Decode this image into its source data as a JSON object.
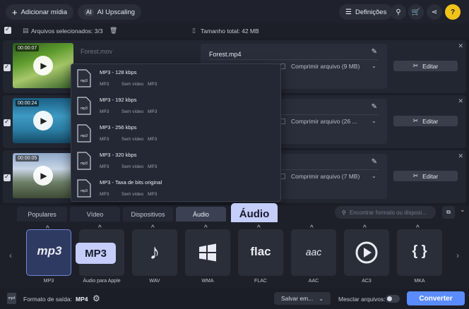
{
  "toolbar": {
    "add_media_label": "Adicionar mídia",
    "ai_upscaling_label": "AI Upscaling",
    "settings_label": "Definições"
  },
  "selection": {
    "selected_label": "Arquivos selecionados: 3/3",
    "total_size_label": "Tamanho total: 42 MB"
  },
  "files": [
    {
      "duration": "00:00:07",
      "input_name": "Forest.mov",
      "output_name": "Forest.mp4",
      "compress_label": "Comprimir arquivo (9 MB)",
      "edit_label": "Editar"
    },
    {
      "duration": "00:00:24",
      "input_name": "",
      "output_name": "",
      "compress_label": "Comprimir arquivo (26 ...",
      "edit_label": "Editar"
    },
    {
      "duration": "00:00:05",
      "input_name": "",
      "output_name": "",
      "compress_label": "Comprimir arquivo (7 MB)",
      "edit_label": "Editar"
    }
  ],
  "dropdown": {
    "items": [
      {
        "name": "MP3 - 128 kbps",
        "col1": "MP3",
        "col2": "Sem vídeo",
        "col3": "MP3"
      },
      {
        "name": "MP3 - 192 kbps",
        "col1": "MP3",
        "col2": "Sem vídeo",
        "col3": "MP3"
      },
      {
        "name": "MP3 - 256 kbps",
        "col1": "MP3",
        "col2": "Sem vídeo",
        "col3": "MP3"
      },
      {
        "name": "MP3 - 320 kbps",
        "col1": "MP3",
        "col2": "Sem vídeo",
        "col3": "MP3"
      },
      {
        "name": "MP3 - Taxa de bits original",
        "col1": "MP3",
        "col2": "Sem vídeo",
        "col3": "MP3"
      }
    ]
  },
  "tabs": [
    {
      "label": "Populares"
    },
    {
      "label": "Vídeo"
    },
    {
      "label": "Dispositivos"
    },
    {
      "label": "Áudio"
    }
  ],
  "search": {
    "placeholder": "Encontrar formato ou disposi..."
  },
  "tooltips": {
    "audio": "Áudio",
    "mp3": "MP3"
  },
  "formats": [
    {
      "label": "MP3",
      "icon": "mp3-icon"
    },
    {
      "label": "Áudio para Apple",
      "icon": "apple-audio-icon"
    },
    {
      "label": "WAV",
      "icon": "music-note-icon"
    },
    {
      "label": "WMA",
      "icon": "windows-icon"
    },
    {
      "label": "FLAC",
      "icon": "flac-icon"
    },
    {
      "label": "AAC",
      "icon": "aac-icon"
    },
    {
      "label": "AC3",
      "icon": "ac3-icon"
    },
    {
      "label": "MKA",
      "icon": "mka-icon"
    }
  ],
  "bottom": {
    "output_format_label": "Formato de saída:",
    "output_format_value": "MP4",
    "save_label": "Salvar em...",
    "merge_label": "Mesclar arquivos:",
    "convert_label": "Converter"
  },
  "colors": {
    "accent": "#5b8cff",
    "tooltip": "#c5cdfa",
    "help": "#f0c419"
  }
}
